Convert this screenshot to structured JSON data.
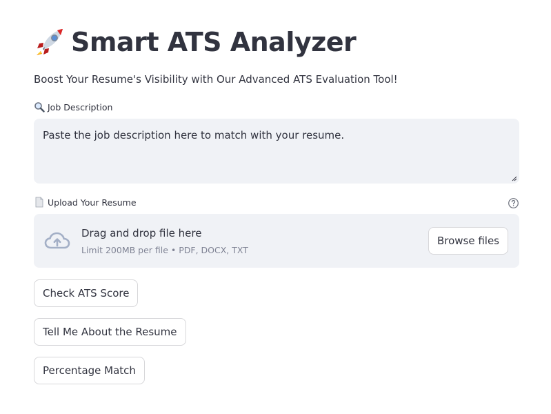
{
  "header": {
    "title": "Smart ATS Analyzer",
    "icon": "rocket-icon",
    "tagline": "Boost Your Resume's Visibility with Our Advanced ATS Evaluation Tool!"
  },
  "job_description": {
    "label": "Job Description",
    "label_icon": "magnifying-glass-icon",
    "placeholder": "Paste the job description here to match with your resume.",
    "value": ""
  },
  "upload": {
    "label": "Upload Your Resume",
    "label_icon": "document-icon",
    "help_icon": "question-circle-icon",
    "drop_text": "Drag and drop file here",
    "limit_text": "Limit 200MB per file • PDF, DOCX, TXT",
    "browse_label": "Browse files",
    "cloud_icon": "cloud-upload-icon"
  },
  "actions": [
    {
      "label": "Check ATS Score"
    },
    {
      "label": "Tell Me About the Resume"
    },
    {
      "label": "Percentage Match"
    }
  ],
  "colors": {
    "text": "#31333f",
    "muted": "#808495",
    "field_bg": "#f0f2f6",
    "border": "#d6d6d9",
    "icon_blue": "#a3afc6"
  }
}
